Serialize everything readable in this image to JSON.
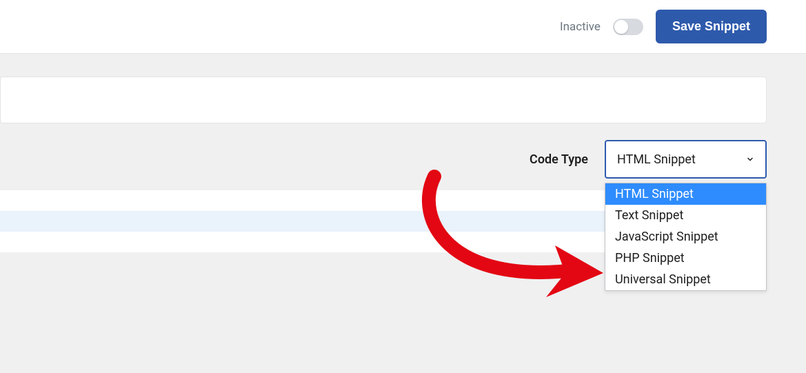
{
  "header": {
    "status_label": "Inactive",
    "save_button": "Save Snippet"
  },
  "title_input": {
    "value": ""
  },
  "code_type": {
    "label": "Code Type",
    "selected": "HTML Snippet",
    "options": [
      "HTML Snippet",
      "Text Snippet",
      "JavaScript Snippet",
      "PHP Snippet",
      "Universal Snippet"
    ]
  }
}
